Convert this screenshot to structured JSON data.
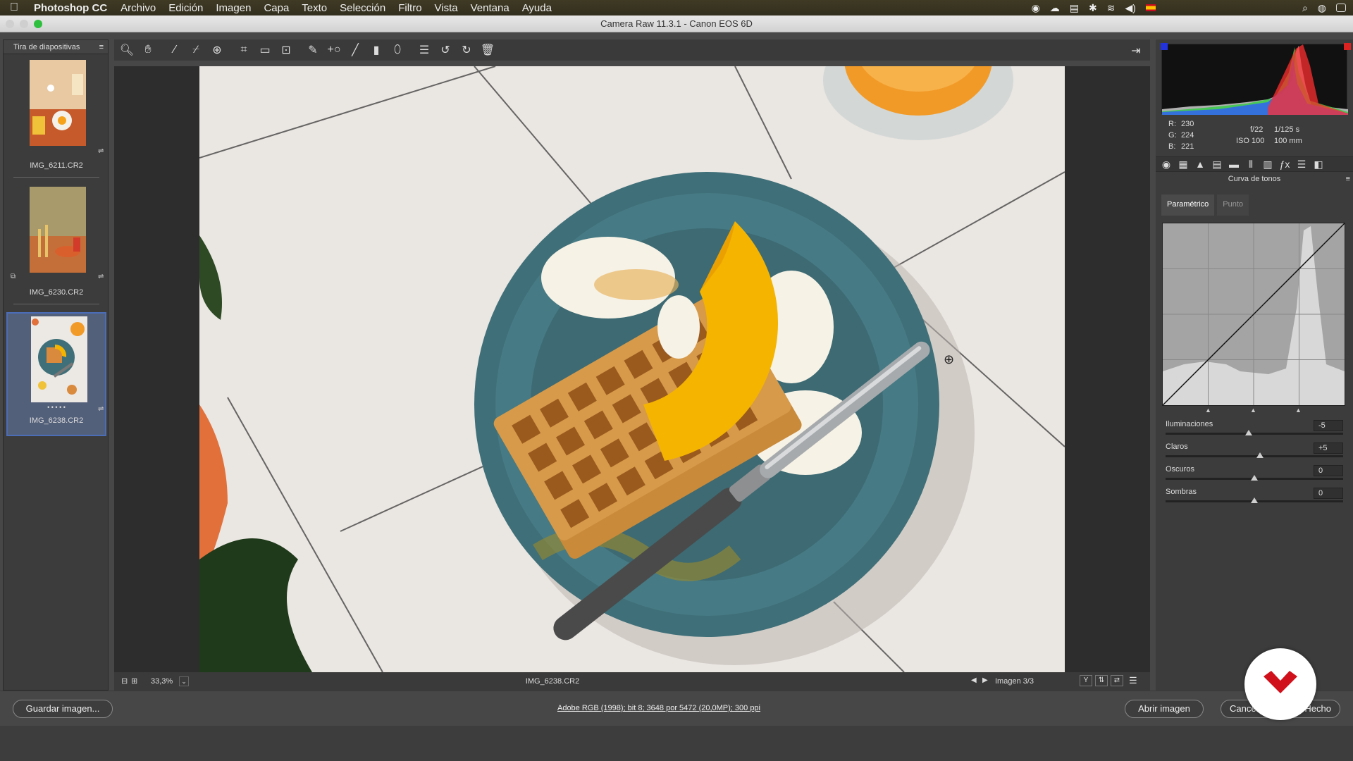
{
  "menubar": {
    "apple_icon": "apple-icon",
    "app_name": "Photoshop CC",
    "items": [
      "Archivo",
      "Edición",
      "Imagen",
      "Capa",
      "Texto",
      "Selección",
      "Filtro",
      "Vista",
      "Ventana",
      "Ayuda"
    ]
  },
  "window": {
    "title": "Camera Raw 11.3.1 -  Canon EOS 6D"
  },
  "filmstrip": {
    "title": "Tira de diapositivas",
    "items": [
      {
        "name": "IMG_6211.CR2",
        "selected": false
      },
      {
        "name": "IMG_6230.CR2",
        "selected": false
      },
      {
        "name": "IMG_6238.CR2",
        "selected": true
      }
    ],
    "rating_dots": "• • • • •"
  },
  "toolbar": {
    "tools": [
      "zoom-tool",
      "hand-tool",
      "white-balance-tool",
      "color-sampler-tool",
      "targeted-adjustment-tool",
      "crop-tool",
      "straighten-tool",
      "transform-tool",
      "spot-removal-tool",
      "red-eye-tool",
      "adjustment-brush-tool",
      "graduated-filter-tool",
      "radial-filter-tool",
      "preferences-tool",
      "rotate-left-tool",
      "rotate-right-tool",
      "trash-tool"
    ]
  },
  "status": {
    "zoom": "33,3%",
    "filename": "IMG_6238.CR2",
    "image_counter": "Imagen 3/3"
  },
  "readout": {
    "r_label": "R:",
    "r_value": "230",
    "g_label": "G:",
    "g_value": "224",
    "b_label": "B:",
    "b_value": "221",
    "aperture": "f/22",
    "shutter": "1/125 s",
    "iso": "ISO 100",
    "focal": "100 mm"
  },
  "panel": {
    "title": "Curva de tonos",
    "tabs": [
      "Paramétrico",
      "Punto"
    ],
    "active_tab": "Paramétrico",
    "sliders": [
      {
        "label": "Iluminaciones",
        "value": "-5",
        "level": 0.47
      },
      {
        "label": "Claros",
        "value": "+5",
        "level": 0.53
      },
      {
        "label": "Oscuros",
        "value": "0",
        "level": 0.5
      },
      {
        "label": "Sombras",
        "value": "0",
        "level": 0.5
      }
    ]
  },
  "bottom": {
    "save_label": "Guardar imagen...",
    "workflow_link": "Adobe RGB (1998); bit 8; 3648 por 5472 (20,0MP); 300 ppi",
    "open_label": "Abrir imagen",
    "cancel_label": "Cancel",
    "done_label": "Hecho"
  },
  "colors": {
    "accent": "#4b6cb7",
    "plate": "#3f6f78",
    "logo_red": "#d0101a"
  }
}
